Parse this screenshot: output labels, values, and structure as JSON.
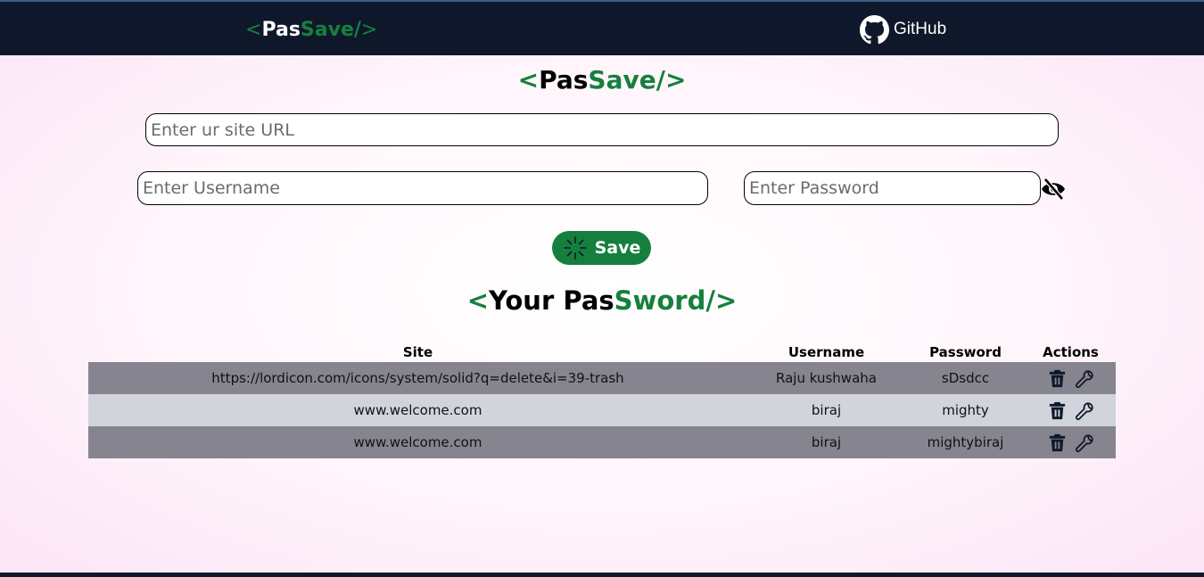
{
  "navbar": {
    "logo": {
      "open": "<",
      "pas": "Pas",
      "save": "Save/",
      "close": ">"
    },
    "github_label": "GitHub"
  },
  "header": {
    "title": {
      "open": "<",
      "pas": "Pas",
      "save": "Save/",
      "close": ">"
    }
  },
  "form": {
    "site_placeholder": "Enter ur site URL",
    "site_value": "",
    "username_placeholder": "Enter Username",
    "username_value": "",
    "password_placeholder": "Enter Password",
    "password_value": "",
    "save_label": "Save"
  },
  "list": {
    "title": {
      "open": "<",
      "pas": "Your Pas",
      "save": "Sword/",
      "close": ">"
    },
    "columns": {
      "site": "Site",
      "username": "Username",
      "password": "Password",
      "actions": "Actions"
    },
    "rows": [
      {
        "site": "https://lordicon.com/icons/system/solid?q=delete&i=39-trash",
        "username": "Raju kushwaha",
        "password": "sDsdcc"
      },
      {
        "site": "www.welcome.com",
        "username": "biraj",
        "password": "mighty"
      },
      {
        "site": "www.welcome.com",
        "username": "biraj",
        "password": "mightybiraj"
      }
    ]
  },
  "colors": {
    "navbar": "#0f172a",
    "accent": "#15803d",
    "row_dark": "#86848f",
    "row_light": "#d1d5db"
  },
  "icons": {
    "github": "github-icon",
    "eye": "eye-slash-icon",
    "save": "loader-icon",
    "delete": "trash-icon",
    "edit": "wrench-icon"
  }
}
